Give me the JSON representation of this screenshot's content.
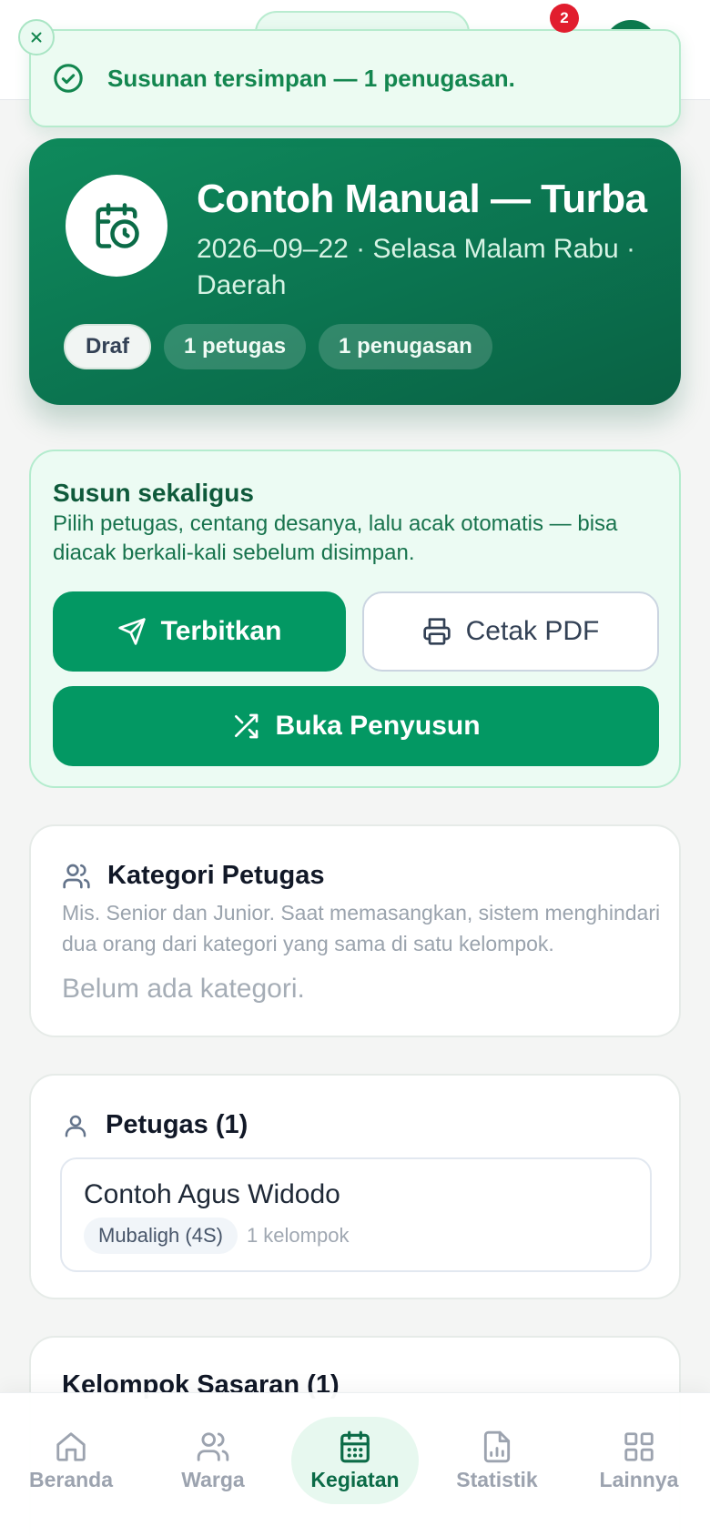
{
  "toast": {
    "message": "Susunan tersimpan — 1 penugasan."
  },
  "header": {
    "notification_count": "2"
  },
  "hero": {
    "title": "Contoh Manual — Turba",
    "subtitle": "2026–09–22 · Selasa Malam Rabu · Daerah",
    "chips": {
      "status": "Draf",
      "officers": "1 petugas",
      "assignments": "1 penugasan"
    }
  },
  "compose": {
    "title": "Susun sekaligus",
    "description": "Pilih petugas, centang desanya, lalu acak otomatis — bisa diacak berkali-kali sebelum disimpan.",
    "publish_label": "Terbitkan",
    "pdf_label": "Cetak PDF",
    "open_label": "Buka Penyusun"
  },
  "categories": {
    "title": "Kategori Petugas",
    "description": "Mis. Senior dan Junior. Saat memasangkan, sistem menghindari dua orang dari kategori yang sama di satu kelompok.",
    "empty": "Belum ada kategori."
  },
  "officers": {
    "title": "Petugas (1)",
    "items": [
      {
        "name": "Contoh Agus Widodo",
        "role": "Mubaligh (4S)",
        "groups": "1 kelompok"
      }
    ]
  },
  "targets": {
    "title": "Kelompok Sasaran (1)"
  },
  "nav": {
    "items": [
      {
        "label": "Beranda",
        "icon": "home-icon"
      },
      {
        "label": "Warga",
        "icon": "users-icon"
      },
      {
        "label": "Kegiatan",
        "icon": "calendar-icon",
        "active": true
      },
      {
        "label": "Statistik",
        "icon": "chart-file-icon"
      },
      {
        "label": "Lainnya",
        "icon": "grid-icon"
      }
    ]
  },
  "colors": {
    "primary": "#039863",
    "hero_dark": "#0a6244",
    "toast_text": "#13864f",
    "badge": "#e11d2e"
  }
}
